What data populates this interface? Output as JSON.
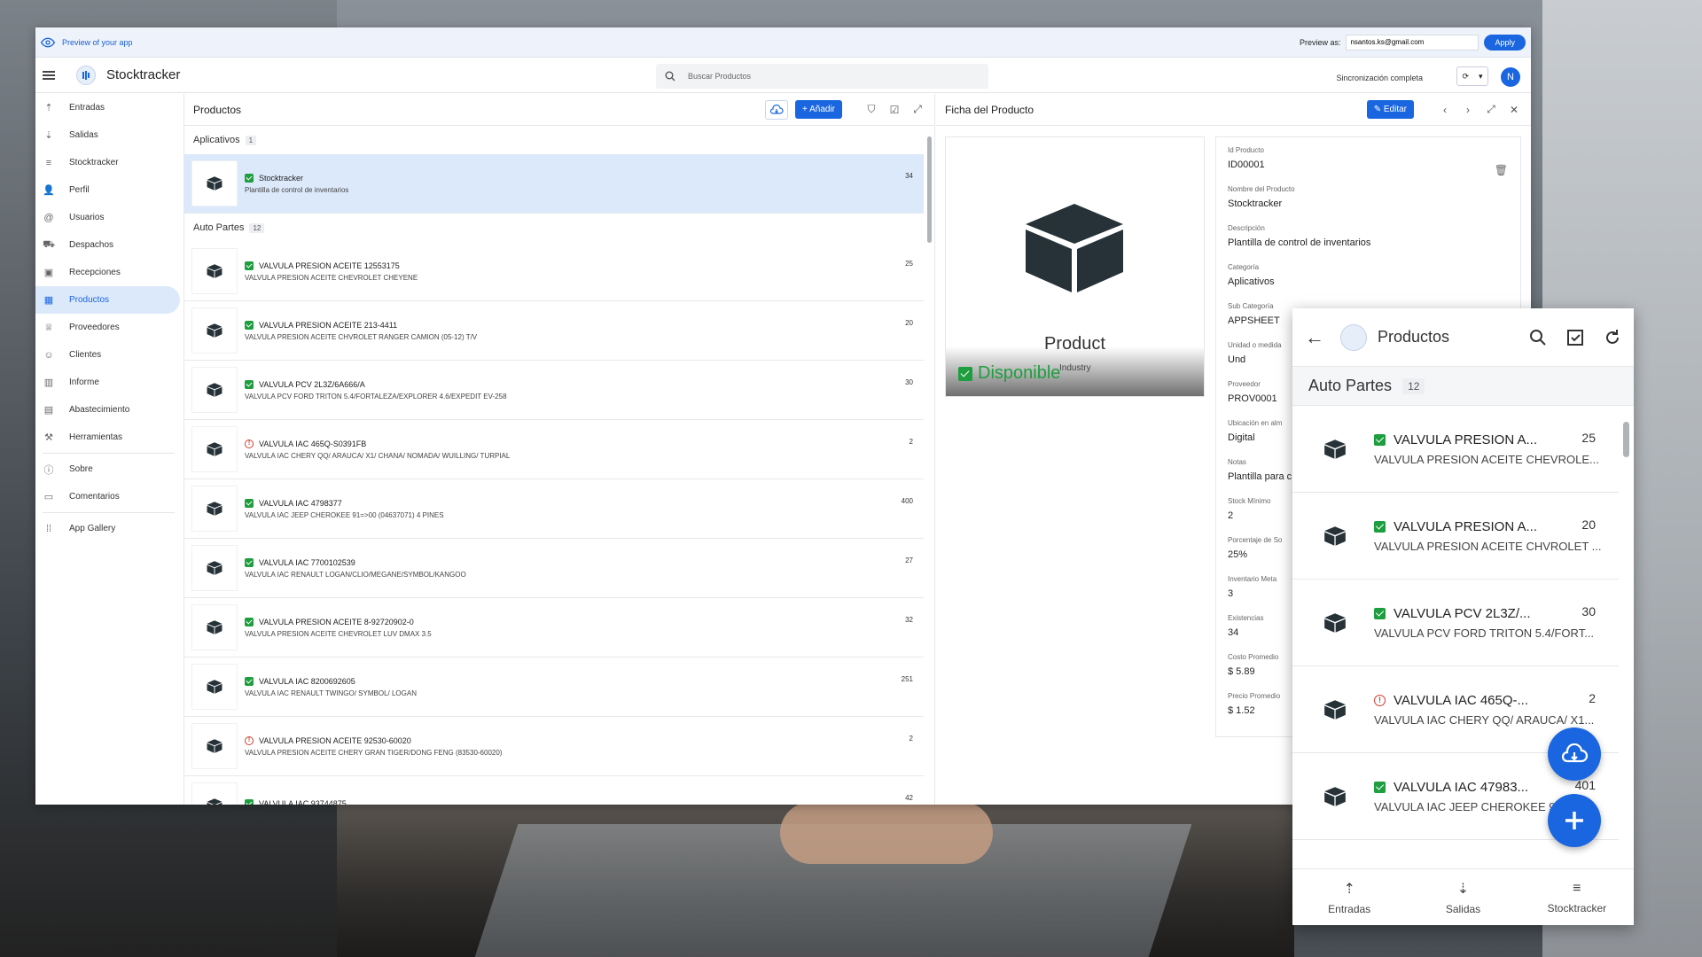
{
  "preview": {
    "label": "Preview of your app",
    "preview_as": "Preview as:",
    "email": "nsantos.ks@gmail.com",
    "apply": "Apply"
  },
  "header": {
    "title": "Stocktracker",
    "search_placeholder": "Buscar Productos",
    "sync_label": "Sincronización completa",
    "avatar": "N"
  },
  "sidebar": {
    "items": [
      {
        "label": "Entradas",
        "icon": "arrow-up-icon",
        "glyph": "⇡"
      },
      {
        "label": "Salidas",
        "icon": "arrow-down-icon",
        "glyph": "⇣"
      },
      {
        "label": "Stocktracker",
        "icon": "menu-lines-icon",
        "glyph": "≡"
      },
      {
        "label": "Perfil",
        "icon": "person-icon",
        "glyph": "👤"
      },
      {
        "label": "Usuarios",
        "icon": "at-icon",
        "glyph": "@"
      },
      {
        "label": "Despachos",
        "icon": "truck-icon",
        "glyph": "⛟"
      },
      {
        "label": "Recepciones",
        "icon": "briefcase-icon",
        "glyph": "▣"
      },
      {
        "label": "Productos",
        "icon": "boxes-icon",
        "glyph": "▦",
        "active": true
      },
      {
        "label": "Proveedores",
        "icon": "trophy-icon",
        "glyph": "♕"
      },
      {
        "label": "Clientes",
        "icon": "people-icon",
        "glyph": "☺"
      },
      {
        "label": "Informe",
        "icon": "chart-icon",
        "glyph": "▥"
      },
      {
        "label": "Abastecimiento",
        "icon": "list-icon",
        "glyph": "▤"
      },
      {
        "label": "Herramientas",
        "icon": "wrench-icon",
        "glyph": "⚒"
      },
      {
        "label": "Sobre",
        "icon": "info-icon",
        "glyph": "ⓘ"
      },
      {
        "label": "Comentarios",
        "icon": "comment-icon",
        "glyph": "▭"
      },
      {
        "label": "App Gallery",
        "icon": "grid-icon",
        "glyph": "⁞⁞"
      }
    ]
  },
  "list": {
    "title": "Productos",
    "add_label": "Añadir",
    "groups": [
      {
        "name": "Aplicativos",
        "count": "1",
        "rows": [
          {
            "title": "Stocktracker",
            "sub": "Plantilla de control de inventarios",
            "num": "34",
            "status": "ok",
            "selected": true
          }
        ]
      },
      {
        "name": "Auto Partes",
        "count": "12",
        "rows": [
          {
            "title": "VALVULA PRESION ACEITE 12553175",
            "sub": "VALVULA PRESION ACEITE CHEVROLET CHEYENE",
            "num": "25",
            "status": "ok"
          },
          {
            "title": "VALVULA PRESION ACEITE 213-4411",
            "sub": "VALVULA PRESION ACEITE CHVROLET RANGER CAMION (05-12) T/V",
            "num": "20",
            "status": "ok"
          },
          {
            "title": "VALVULA PCV 2L3Z/6A666/A",
            "sub": "VALVULA PCV FORD TRITON 5.4/FORTALEZA/EXPLORER 4.6/EXPEDIT EV-258",
            "num": "30",
            "status": "ok"
          },
          {
            "title": "VALVULA IAC 465Q-S0391FB",
            "sub": "VALVULA IAC CHERY QQ/ ARAUCA/ X1/ CHANA/ NOMADA/ WUILLING/ TURPIAL",
            "num": "2",
            "status": "warn"
          },
          {
            "title": "VALVULA IAC 4798377",
            "sub": "VALVULA IAC JEEP CHEROKEE 91=>00 (04637071) 4 PINES",
            "num": "400",
            "status": "ok"
          },
          {
            "title": "VALVULA IAC 7700102539",
            "sub": "VALVULA IAC RENAULT LOGAN/CLIO/MEGANE/SYMBOL/KANGOO",
            "num": "27",
            "status": "ok"
          },
          {
            "title": "VALVULA PRESION ACEITE 8-92720902-0",
            "sub": "VALVULA PRESION ACEITE CHEVROLET LUV DMAX 3.5",
            "num": "32",
            "status": "ok"
          },
          {
            "title": "VALVULA IAC 8200692605",
            "sub": "VALVULA IAC RENAULT TWINGO/ SYMBOL/ LOGAN",
            "num": "251",
            "status": "ok"
          },
          {
            "title": "VALVULA PRESION ACEITE 92530-60020",
            "sub": "VALVULA PRESION ACEITE CHERY GRAN TIGER/DONG FENG (83530-60020)",
            "num": "2",
            "status": "warn"
          },
          {
            "title": "VALVULA IAC 93744875",
            "sub": "",
            "num": "42",
            "status": "ok"
          }
        ]
      }
    ]
  },
  "detail": {
    "title": "Ficha del Producto",
    "edit_label": "Editar",
    "image_text": "Product",
    "image_badge": "Disponible",
    "image_sub": "Industry",
    "fields": [
      {
        "label": "Id Producto",
        "value": "ID00001"
      },
      {
        "label": "Nombre del Producto",
        "value": "Stocktracker"
      },
      {
        "label": "Descripción",
        "value": "Plantilla de control de inventarios"
      },
      {
        "label": "Categoría",
        "value": "Aplicativos"
      },
      {
        "label": "Sub Categoría",
        "value": "APPSHEET"
      },
      {
        "label": "Unidad o medida",
        "value": "Und"
      },
      {
        "label": "Proveedor",
        "value": "PROV0001"
      },
      {
        "label": "Ubicación en alm",
        "value": "Digital"
      },
      {
        "label": "Notas",
        "value": "Plantilla para c"
      },
      {
        "label": "Stock Mínimo",
        "value": "2"
      },
      {
        "label": "Porcentaje de So",
        "value": "25%"
      },
      {
        "label": "Inventario Meta",
        "value": "3"
      },
      {
        "label": "Existencias",
        "value": "34"
      },
      {
        "label": "Costo Promedio",
        "value": "$ 5.89"
      },
      {
        "label": "Precio Promedio",
        "value": "$ 1.52"
      }
    ]
  },
  "mobile": {
    "title": "Productos",
    "group": "Auto Partes",
    "count": "12",
    "rows": [
      {
        "title": "VALVULA PRESION A...",
        "sub": "VALVULA PRESION ACEITE CHEVROLE...",
        "num": "25",
        "status": "ok"
      },
      {
        "title": "VALVULA PRESION A...",
        "sub": "VALVULA PRESION ACEITE CHVROLET ...",
        "num": "20",
        "status": "ok"
      },
      {
        "title": "VALVULA PCV 2L3Z/...",
        "sub": "VALVULA PCV FORD TRITON 5.4/FORT...",
        "num": "30",
        "status": "ok"
      },
      {
        "title": "VALVULA IAC 465Q-...",
        "sub": "VALVULA IAC CHERY QQ/ ARAUCA/ X1...",
        "num": "2",
        "status": "warn"
      },
      {
        "title": "VALVULA IAC 47983...",
        "sub": "VALVULA IAC JEEP CHEROKEE 9",
        "num": "401",
        "status": "ok"
      }
    ],
    "tabs": [
      {
        "label": "Entradas",
        "glyph": "⇡"
      },
      {
        "label": "Salidas",
        "glyph": "⇣"
      },
      {
        "label": "Stocktracker",
        "glyph": "≡"
      }
    ]
  },
  "colors": {
    "accent": "#1a66e0",
    "ok": "#1e9e3e",
    "warn": "#d13c2c",
    "selected": "#dce9fb"
  }
}
